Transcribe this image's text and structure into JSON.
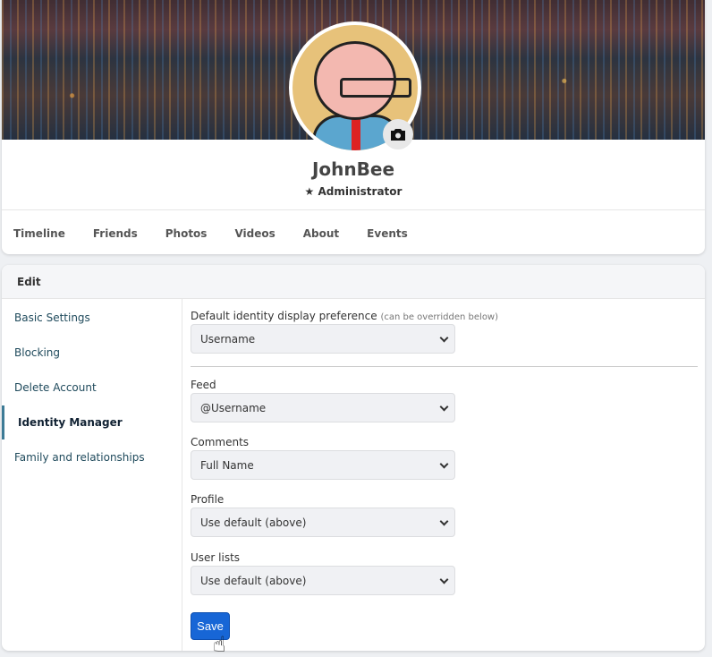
{
  "profile": {
    "name": "JohnBee",
    "role": "Administrator"
  },
  "tabs": [
    "Timeline",
    "Friends",
    "Photos",
    "Videos",
    "About",
    "Events"
  ],
  "edit": {
    "title": "Edit",
    "sidebar": [
      "Basic Settings",
      "Blocking",
      "Delete Account",
      "Identity Manager",
      "Family and relationships"
    ],
    "active": "Identity Manager",
    "default_label": "Default identity display preference",
    "default_hint": "(can be overridden below)",
    "default_value": "Username",
    "fields": [
      {
        "label": "Feed",
        "value": "@Username"
      },
      {
        "label": "Comments",
        "value": "Full Name"
      },
      {
        "label": "Profile",
        "value": "Use default (above)"
      },
      {
        "label": "User lists",
        "value": "Use default (above)"
      }
    ],
    "save": "Save"
  },
  "colors": {
    "accent": "#1766d6",
    "active_border": "#3d7b96"
  }
}
